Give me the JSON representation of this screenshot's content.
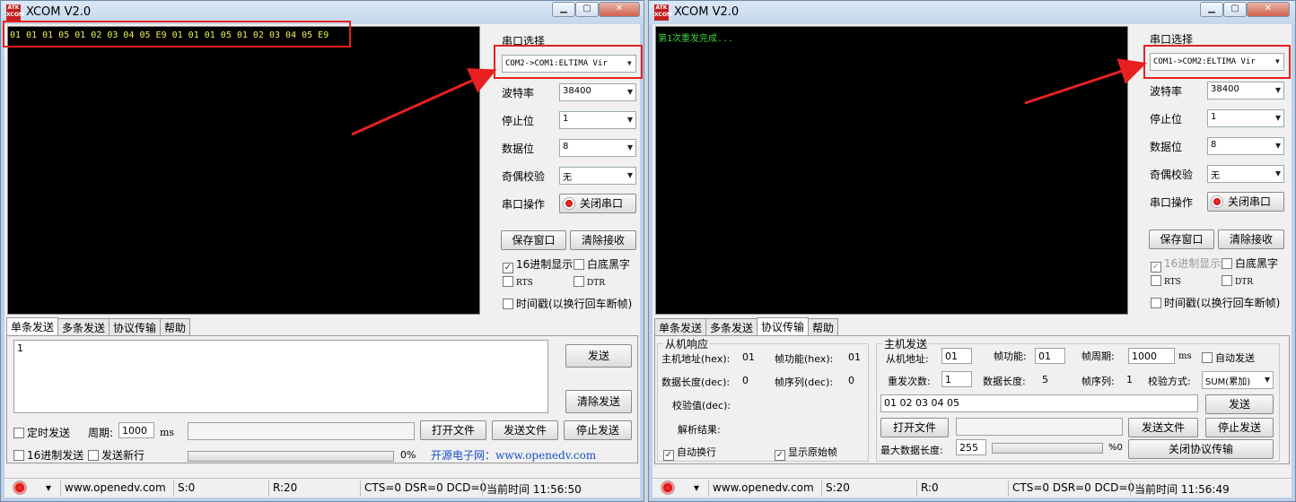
{
  "left": {
    "title": "XCOM V2.0",
    "recv_text": "01 01 01 05 01 02 03 04 05 E9 01 01 01 05 01 02 03 04 05 E9",
    "port_label": "串口选择",
    "port_value": "COM2->COM1:ELTIMA Vir",
    "baud_label": "波特率",
    "baud_value": "38400",
    "stop_label": "停止位",
    "stop_value": "1",
    "data_label": "数据位",
    "data_value": "8",
    "parity_label": "奇偶校验",
    "parity_value": "无",
    "op_label": "串口操作",
    "op_button": "关闭串口",
    "save_btn": "保存窗口",
    "clear_btn": "清除接收",
    "hex_show": "16进制显示",
    "white_bg": "白底黑字",
    "rts": "RTS",
    "dtr": "DTR",
    "timestamp": "时间戳(以换行回车断帧)",
    "tabs": [
      "单条发送",
      "多条发送",
      "协议传输",
      "帮助"
    ],
    "send_text": "1",
    "send_btn": "发送",
    "clear_send_btn": "清除发送",
    "timed_send": "定时发送",
    "period_label": "周期:",
    "period_value": "1000",
    "ms": "ms",
    "open_file": "打开文件",
    "send_file": "发送文件",
    "stop_send": "停止发送",
    "hex_send": "16进制发送",
    "send_newline": "发送新行",
    "percent": "0%",
    "banner": "开源电子网：www.openedv.com",
    "status": {
      "site": "www.openedv.com",
      "s": "S:0",
      "r": "R:20",
      "lines": "CTS=0 DSR=0 DCD=0",
      "time": "当前时间 11:56:50"
    }
  },
  "right": {
    "title": "XCOM V2.0",
    "recv_text": "第1次重发完成...",
    "port_label": "串口选择",
    "port_value": "COM1->COM2:ELTIMA Vir",
    "baud_label": "波特率",
    "baud_value": "38400",
    "stop_label": "停止位",
    "stop_value": "1",
    "data_label": "数据位",
    "data_value": "8",
    "parity_label": "奇偶校验",
    "parity_value": "无",
    "op_label": "串口操作",
    "op_button": "关闭串口",
    "save_btn": "保存窗口",
    "clear_btn": "清除接收",
    "hex_show": "16进制显示",
    "white_bg": "白底黑字",
    "rts": "RTS",
    "dtr": "DTR",
    "timestamp": "时间戳(以换行回车断帧)",
    "tabs": [
      "单条发送",
      "多条发送",
      "协议传输",
      "帮助"
    ],
    "slave": {
      "title": "从机响应",
      "addr_label": "主机地址(hex):",
      "addr_value": "01",
      "func_label": "帧功能(hex):",
      "func_value": "01",
      "len_label": "数据长度(dec):",
      "len_value": "0",
      "seq_label": "帧序列(dec):",
      "seq_value": "0",
      "chk_label": "校验值(dec):",
      "parse_label": "解析结果:",
      "auto_wrap": "自动换行",
      "show_raw": "显示原始帧"
    },
    "master": {
      "title": "主机发送",
      "addr_label": "从机地址:",
      "addr_value": "01",
      "func_label": "帧功能:",
      "func_value": "01",
      "period_label": "帧周期:",
      "period_value": "1000",
      "ms": "ms",
      "auto_send": "自动发送",
      "retry_label": "重发次数:",
      "retry_value": "1",
      "len_label": "数据长度:",
      "len_value": "5",
      "seq_label": "帧序列:",
      "seq_value": "1",
      "chk_label": "校验方式:",
      "chk_value": "SUM(累加)",
      "data_value": "01 02 03 04 05",
      "send_btn": "发送",
      "open_file": "打开文件",
      "send_file": "发送文件",
      "stop_send": "停止发送",
      "max_len_label": "最大数据长度:",
      "max_len_value": "255",
      "percent": "%0",
      "close_proto": "关闭协议传输"
    },
    "status": {
      "site": "www.openedv.com",
      "s": "S:20",
      "r": "R:0",
      "lines": "CTS=0 DSR=0 DCD=0",
      "time": "当前时间 11:56:49"
    }
  },
  "colors": {
    "highlight": "#e82020",
    "recv_text_left": "#e8f05a",
    "recv_text_right": "#3fd03f"
  }
}
